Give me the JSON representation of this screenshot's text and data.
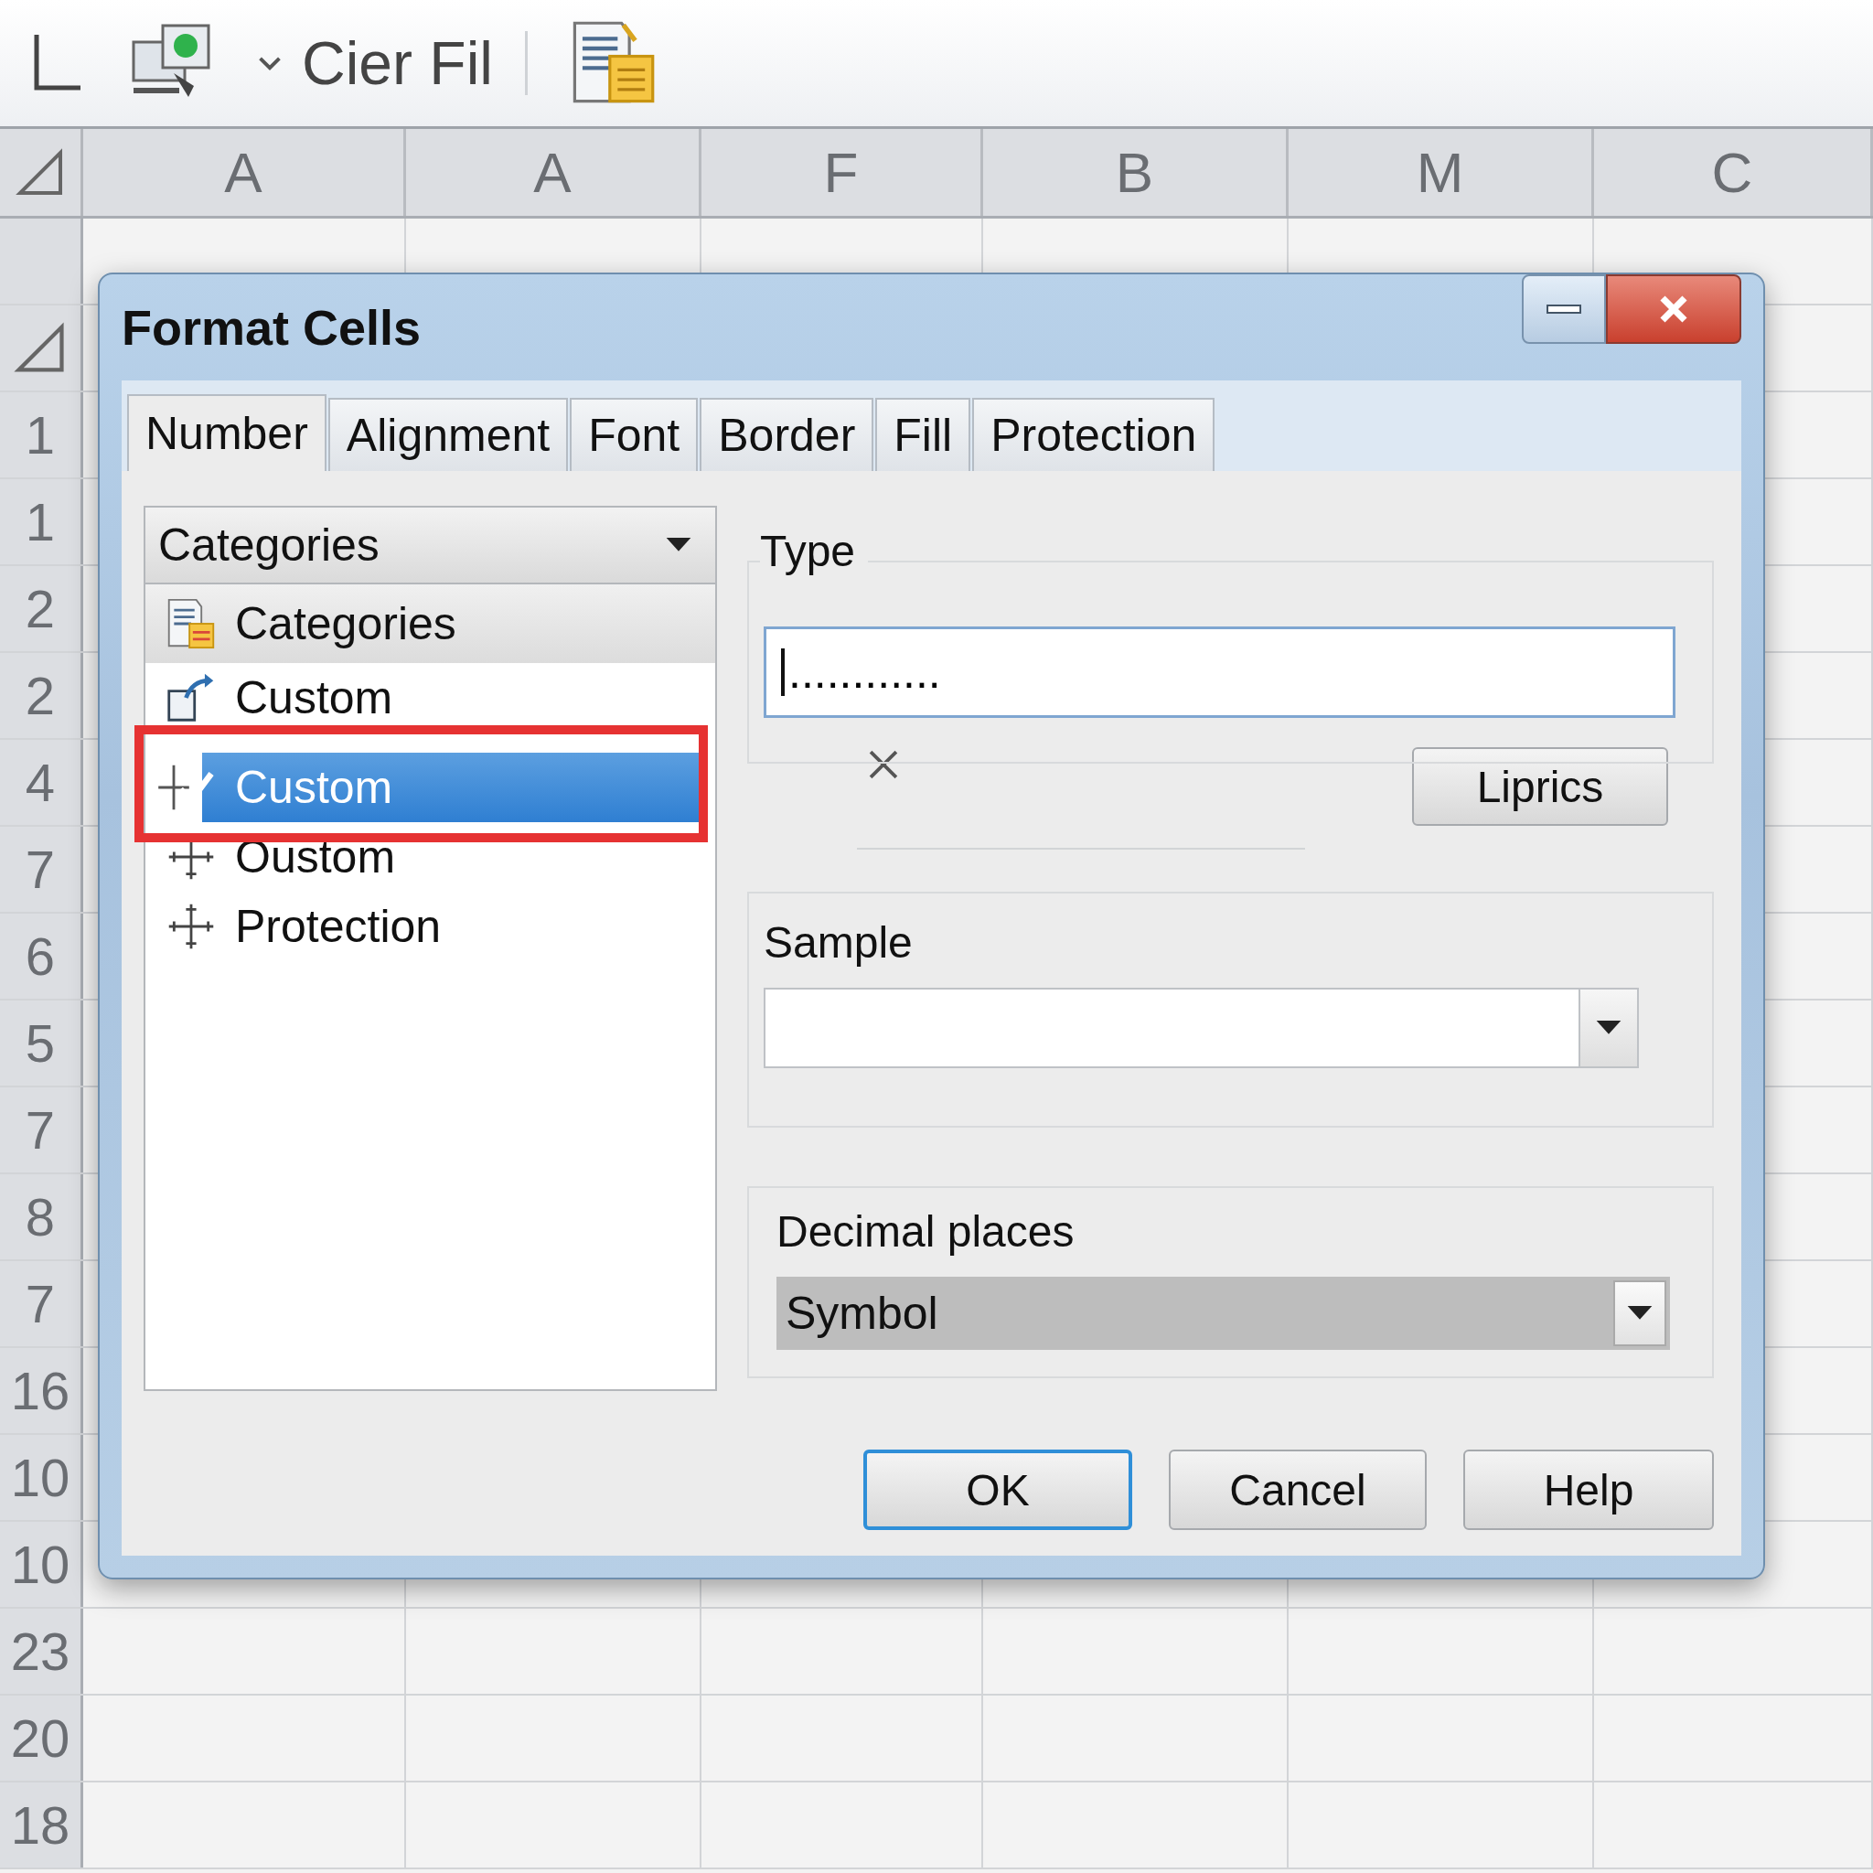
{
  "toolbar": {
    "label": "Cier Fil"
  },
  "columns": [
    "A",
    "A",
    "F",
    "B",
    "M",
    "C"
  ],
  "rows": [
    "1",
    "1",
    "2",
    "2",
    "4",
    "7",
    "6",
    "5",
    "7",
    "8",
    "7",
    "16",
    "10",
    "10",
    "23",
    "20",
    "18"
  ],
  "dialog": {
    "title": "Format Cells",
    "tabs": [
      {
        "label": "Number",
        "selected": true
      },
      {
        "label": "Alignment",
        "selected": false
      },
      {
        "label": "Font",
        "selected": false
      },
      {
        "label": "Border",
        "selected": false
      },
      {
        "label": "Fill",
        "selected": false
      },
      {
        "label": "Protection",
        "selected": false
      }
    ],
    "category_select": {
      "value": "Categories"
    },
    "category_list": [
      {
        "label": "Categories",
        "kind": "header",
        "selected": false
      },
      {
        "label": "Custom",
        "kind": "arrow",
        "selected": false
      },
      {
        "label": "Custom",
        "kind": "check",
        "selected": true
      },
      {
        "label": "Oustom",
        "kind": "move",
        "selected": false
      },
      {
        "label": "Protection",
        "kind": "move",
        "selected": false
      }
    ],
    "type": {
      "label": "Type",
      "value": "............"
    },
    "side_button": "Liprics",
    "sample": {
      "label": "Sample"
    },
    "decimal": {
      "label": "Decimal places",
      "value": "Symbol"
    },
    "buttons": [
      {
        "label": "OK",
        "default": true
      },
      {
        "label": "Cancel",
        "default": false
      },
      {
        "label": "Help",
        "default": false
      }
    ]
  }
}
